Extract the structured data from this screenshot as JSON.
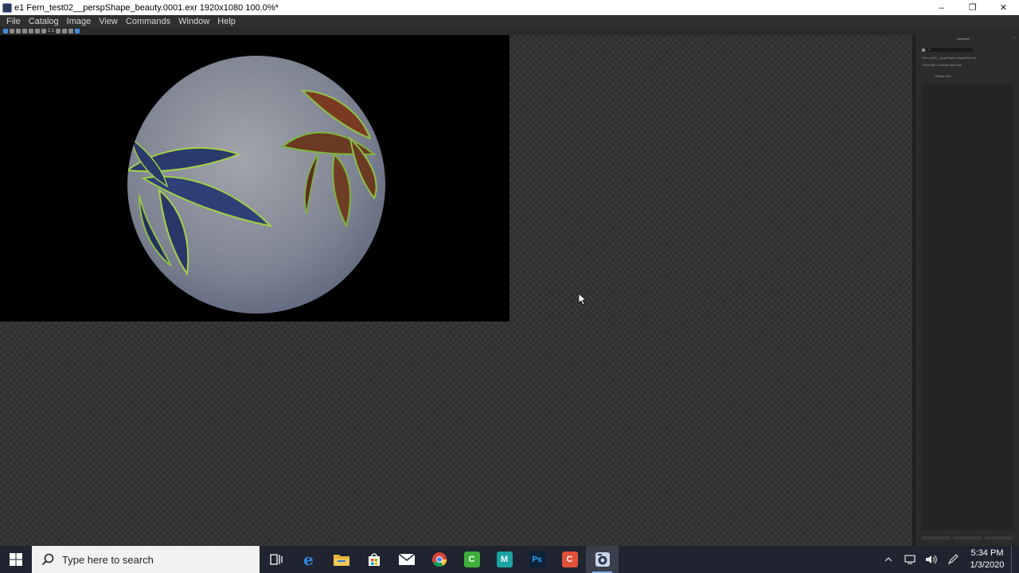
{
  "window": {
    "title": "e1 Fern_test02__perspShape_beauty.0001.exr 1920x1080 100.0%*",
    "minimize": "–",
    "restore": "❐",
    "close": "✕"
  },
  "menu": [
    "File",
    "Catalog",
    "Image",
    "View",
    "Commands",
    "Window",
    "Help"
  ],
  "toolbar": {
    "zoom_label": "1:1"
  },
  "inspector": {
    "title": "Inspector",
    "name_field": "e1",
    "file_name": "Fern_test02__perspShape_beauty.0001.exr",
    "file_info": "1920x1080  4 channel 16bit float",
    "button": "Catalog View"
  },
  "taskbar": {
    "search_placeholder": "Type here to search",
    "apps": [
      {
        "name": "task-view",
        "label": "",
        "color": "#1f2430",
        "running": false,
        "active": false
      },
      {
        "name": "edge",
        "label": "e",
        "color": "#1f6fd0",
        "running": false,
        "active": false
      },
      {
        "name": "file-explorer",
        "label": "",
        "color": "#e8b53a",
        "running": false,
        "active": false
      },
      {
        "name": "store",
        "label": "",
        "color": "#ffffff",
        "running": false,
        "active": false
      },
      {
        "name": "mail",
        "label": "",
        "color": "#ffffff",
        "running": false,
        "active": false
      },
      {
        "name": "chrome",
        "label": "",
        "color": "#e04a3b",
        "running": false,
        "active": false
      },
      {
        "name": "camtasia",
        "label": "C",
        "color": "#3fae3a",
        "running": false,
        "active": false
      },
      {
        "name": "maya",
        "label": "M",
        "color": "#1aa3a0",
        "running": false,
        "active": false
      },
      {
        "name": "photoshop",
        "label": "Ps",
        "color": "#0c2338",
        "running": false,
        "active": false
      },
      {
        "name": "recorder",
        "label": "C",
        "color": "#e0503a",
        "running": false,
        "active": false
      },
      {
        "name": "image-viewer",
        "label": "",
        "color": "#c9d6ea",
        "running": true,
        "active": true
      }
    ],
    "time": "5:34 PM",
    "date": "1/3/2020"
  },
  "colors": {
    "menubar": "#303030",
    "viewer_checker": "#2f2f2f",
    "accent": "#3f8fe0"
  }
}
